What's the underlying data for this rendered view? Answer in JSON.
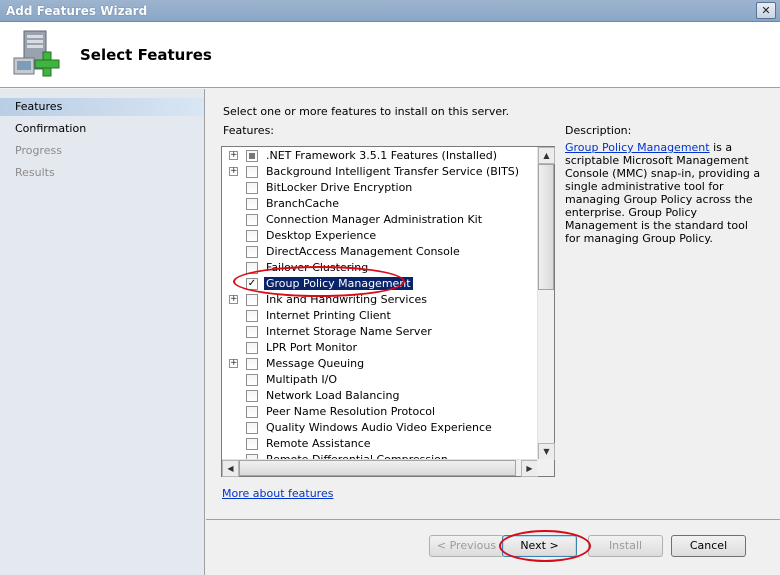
{
  "window": {
    "title": "Add Features Wizard",
    "close_glyph": "✕"
  },
  "header": {
    "heading": "Select Features",
    "icon": "server-add-icon"
  },
  "nav": {
    "items": [
      {
        "label": "Features",
        "state": "active"
      },
      {
        "label": "Confirmation",
        "state": "normal"
      },
      {
        "label": "Progress",
        "state": "disabled"
      },
      {
        "label": "Results",
        "state": "disabled"
      }
    ]
  },
  "main": {
    "intro": "Select one or more features to install on this server.",
    "features_label": "Features:",
    "features": [
      {
        "label": ".NET Framework 3.5.1 Features  (Installed)",
        "expandable": true,
        "check": "partial"
      },
      {
        "label": "Background Intelligent Transfer Service (BITS)",
        "expandable": true,
        "check": "none"
      },
      {
        "label": "BitLocker Drive Encryption",
        "expandable": false,
        "check": "none"
      },
      {
        "label": "BranchCache",
        "expandable": false,
        "check": "none"
      },
      {
        "label": "Connection Manager Administration Kit",
        "expandable": false,
        "check": "none"
      },
      {
        "label": "Desktop Experience",
        "expandable": false,
        "check": "none"
      },
      {
        "label": "DirectAccess Management Console",
        "expandable": false,
        "check": "none"
      },
      {
        "label": "Failover Clustering",
        "expandable": false,
        "check": "none"
      },
      {
        "label": "Group Policy Management",
        "expandable": false,
        "check": "checked",
        "selected": true
      },
      {
        "label": "Ink and Handwriting Services",
        "expandable": true,
        "check": "none"
      },
      {
        "label": "Internet Printing Client",
        "expandable": false,
        "check": "none"
      },
      {
        "label": "Internet Storage Name Server",
        "expandable": false,
        "check": "none"
      },
      {
        "label": "LPR Port Monitor",
        "expandable": false,
        "check": "none"
      },
      {
        "label": "Message Queuing",
        "expandable": true,
        "check": "none"
      },
      {
        "label": "Multipath I/O",
        "expandable": false,
        "check": "none"
      },
      {
        "label": "Network Load Balancing",
        "expandable": false,
        "check": "none"
      },
      {
        "label": "Peer Name Resolution Protocol",
        "expandable": false,
        "check": "none"
      },
      {
        "label": "Quality Windows Audio Video Experience",
        "expandable": false,
        "check": "none"
      },
      {
        "label": "Remote Assistance",
        "expandable": false,
        "check": "none"
      },
      {
        "label": "Remote Differential Compression",
        "expandable": false,
        "check": "none"
      }
    ],
    "description_label": "Description:",
    "description_link": "Group Policy Management",
    "description_text": " is a scriptable Microsoft Management Console (MMC) snap-in, providing a single administrative tool for managing Group Policy across the enterprise. Group Policy Management is the standard tool for managing Group Policy.",
    "more_link": "More about features"
  },
  "buttons": {
    "previous": "< Previous",
    "next": "Next >",
    "install": "Install",
    "cancel": "Cancel"
  },
  "colors": {
    "annotation": "#d80a14",
    "selection": "#0a246a",
    "link": "#0033cc"
  }
}
